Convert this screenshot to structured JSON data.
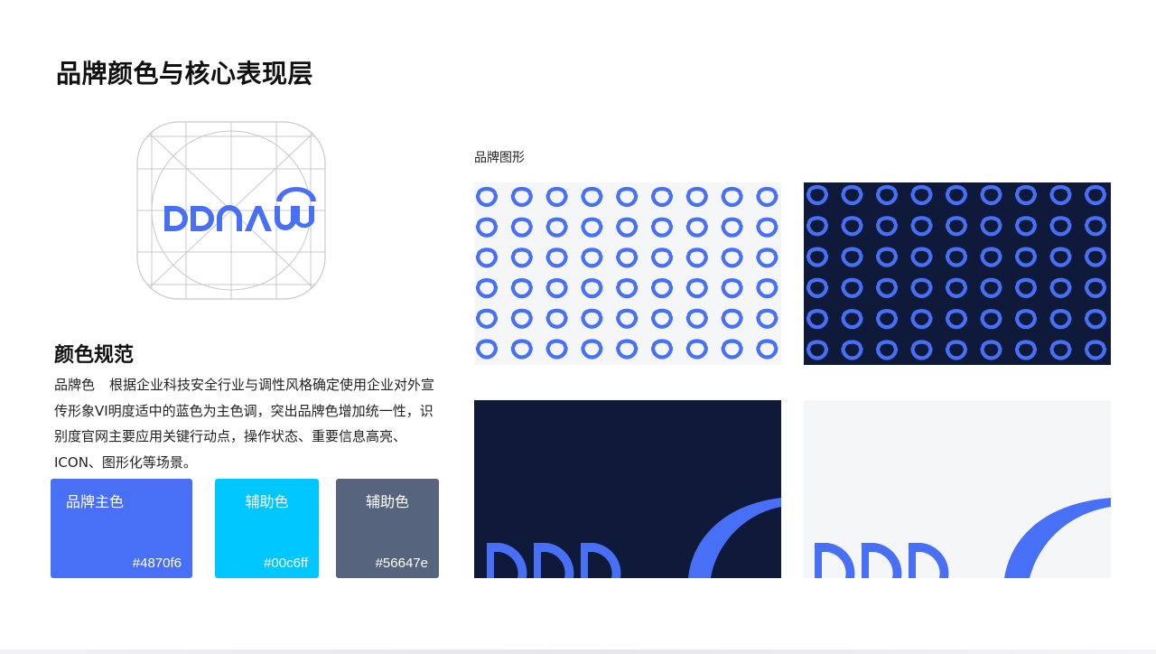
{
  "page": {
    "title": "品牌颜色与核心表现层"
  },
  "logo": {
    "wordmark": "DDNAVV"
  },
  "color_spec": {
    "title": "颜色规范",
    "label": "品牌色",
    "description": "根据企业科技安全行业与调性风格确定使用企业对外宣传形象VI明度适中的蓝色为主色调，突出品牌色增加统一性，识别度官网主要应用关键行动点，操作状态、重要信息高亮、ICON、图形化等场景。"
  },
  "swatches": [
    {
      "name": "品牌主色",
      "hex": "#4870f6"
    },
    {
      "name": "辅助色",
      "hex": "#00c6ff"
    },
    {
      "name": "辅助色",
      "hex": "#56647e"
    }
  ],
  "pattern": {
    "label": "品牌图形",
    "icon": "u-shape-icon",
    "columns": 9,
    "rows": 6
  },
  "colors": {
    "brand": "#4870f6",
    "navy": "#0f1a3b",
    "light": "#f5f6f8",
    "grid_line": "#c8c8c8"
  }
}
